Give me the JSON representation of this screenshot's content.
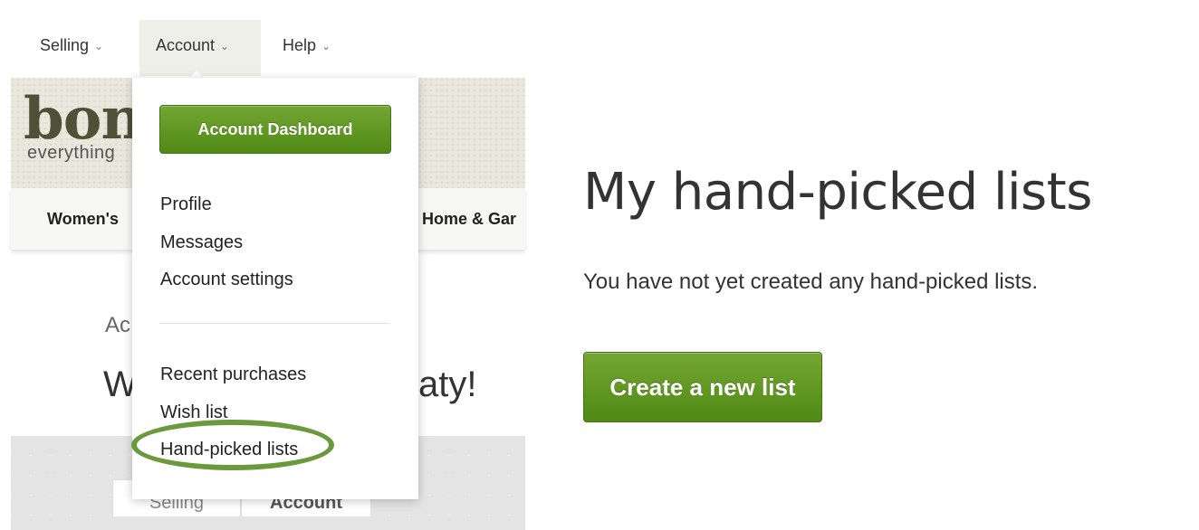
{
  "topnav": {
    "items": [
      {
        "label": "Selling",
        "caret": "⌄"
      },
      {
        "label": "Account",
        "caret": "⌄"
      },
      {
        "label": "Help",
        "caret": "⌄"
      }
    ]
  },
  "background_page": {
    "logo_text": "bon",
    "logo_tagline": "everything",
    "category_left": "Women's",
    "category_right": "Home & Gar",
    "breadcrumb": "Ac",
    "welcome_left": "W",
    "welcome_right": "aty!",
    "tabs": [
      "Selling",
      "Account"
    ]
  },
  "dropdown": {
    "dashboard_button": "Account Dashboard",
    "links_group1": [
      "Profile",
      "Messages",
      "Account settings"
    ],
    "links_group2": [
      "Recent purchases",
      "Wish list",
      "Hand-picked lists"
    ]
  },
  "main": {
    "title": "My hand-picked lists",
    "empty_message": "You have not yet created any hand-picked lists.",
    "create_button": "Create a new list"
  },
  "colors": {
    "accent_green": "#5a9420",
    "highlight_ring": "#6a9a3c",
    "nav_active_bg": "#efefe9"
  }
}
